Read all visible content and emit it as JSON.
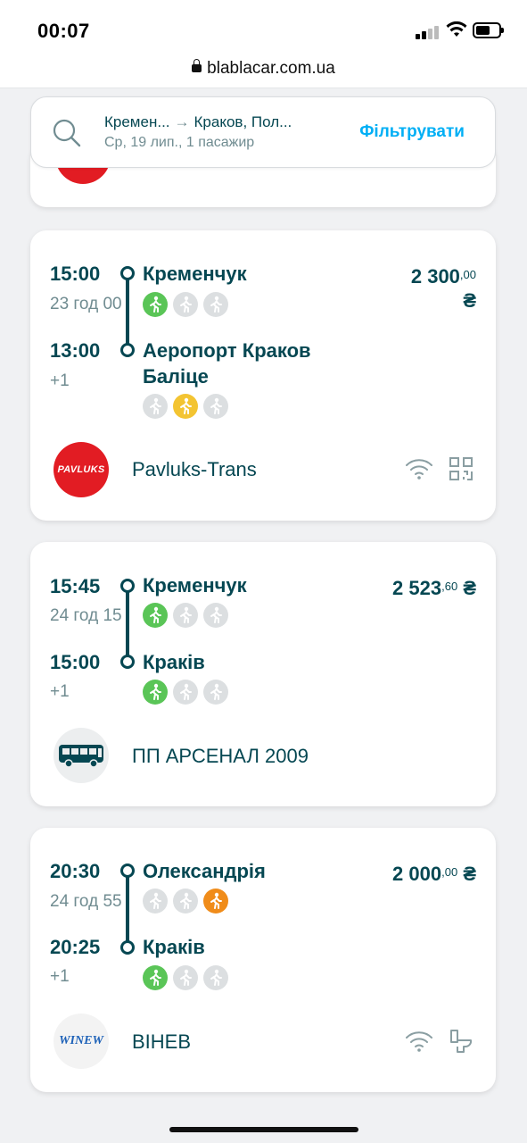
{
  "status": {
    "time": "00:07",
    "url": "blablacar.com.ua"
  },
  "search": {
    "from": "Кремен...",
    "to": "Краков, Пол...",
    "details": "Ср, 19 лип., 1 пасажир",
    "filter_label": "Фільтрувати"
  },
  "trips": [
    {
      "dep_time": "15:00",
      "duration": "23 год 00",
      "from": "Кременчук",
      "to": "Аеропорт Краков Баліце",
      "arr_time": "13:00",
      "plus": "+1",
      "price_main": "2 300",
      "price_cents": ",00",
      "price_currency": "₴",
      "operator": "Pavluks-Trans",
      "operator_logo_text": "PAVLUKS",
      "from_icons": [
        "green",
        "grey",
        "grey"
      ],
      "to_icons": [
        "grey",
        "yellow",
        "grey"
      ],
      "amenities": [
        "wifi-icon",
        "qr-code-icon"
      ]
    },
    {
      "dep_time": "15:45",
      "duration": "24 год 15",
      "from": "Кременчук",
      "to": "Краків",
      "arr_time": "15:00",
      "plus": "+1",
      "price_main": "2 523",
      "price_cents": ",60",
      "price_currency": "₴",
      "operator": "ПП АРСЕНАЛ 2009",
      "from_icons": [
        "green",
        "grey",
        "grey"
      ],
      "to_icons": [
        "green",
        "grey",
        "grey"
      ],
      "amenities": []
    },
    {
      "dep_time": "20:30",
      "duration": "24 год 55",
      "from": "Олександрія",
      "to": "Краків",
      "arr_time": "20:25",
      "plus": "+1",
      "price_main": "2 000",
      "price_cents": ",00",
      "price_currency": "₴",
      "operator": "ВІНЕВ",
      "operator_logo_text": "WINEW",
      "from_icons": [
        "grey",
        "grey",
        "orange"
      ],
      "to_icons": [
        "green",
        "grey",
        "grey"
      ],
      "amenities": [
        "wifi-icon",
        "toilet-icon"
      ]
    }
  ],
  "colors": {
    "primary": "#054752",
    "accent": "#00aff5",
    "green": "#5ac557",
    "yellow": "#f3c432",
    "orange": "#f08c1a"
  }
}
